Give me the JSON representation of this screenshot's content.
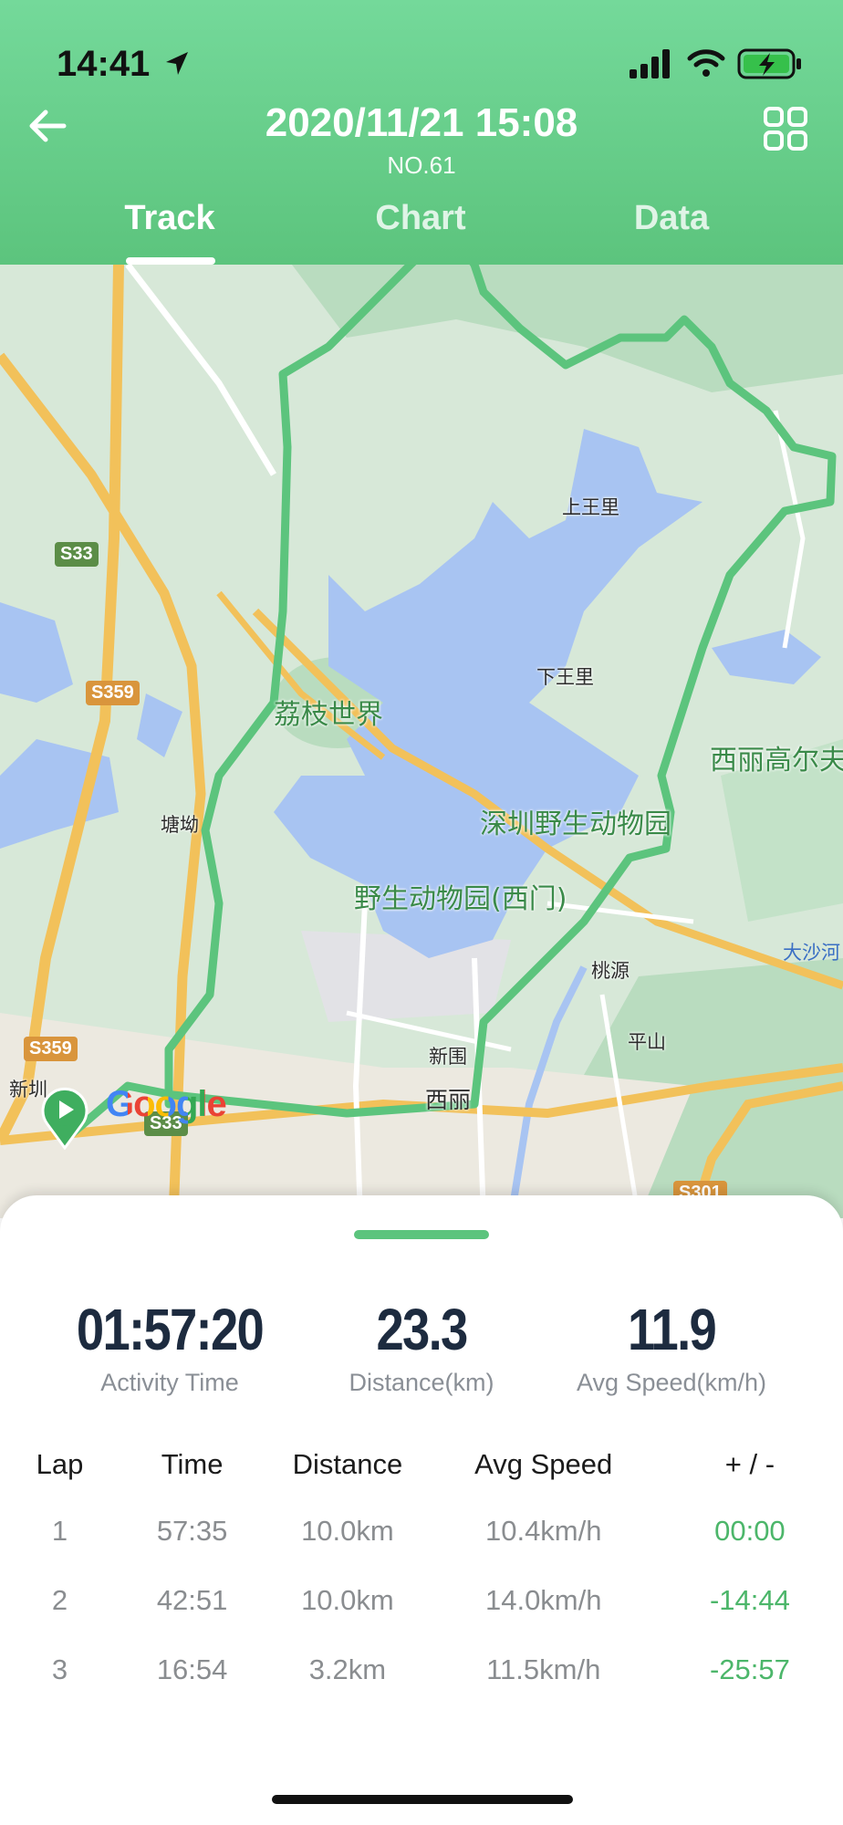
{
  "status_bar": {
    "time": "14:41"
  },
  "header": {
    "title": "2020/11/21 15:08",
    "subtitle": "NO.61"
  },
  "tabs": [
    {
      "label": "Track",
      "active": true
    },
    {
      "label": "Chart",
      "active": false
    },
    {
      "label": "Data",
      "active": false
    }
  ],
  "map": {
    "labels": {
      "lizhi": "荔枝世界",
      "zoo": "深圳野生动物园",
      "zoo_west": "野生动物园(西门)",
      "xili_golf": "西丽高尔夫",
      "shangwangli": "上王里",
      "xiawangli": "下王里",
      "tangao": "塘坳",
      "taoyuan": "桃源",
      "pingshan": "平山",
      "xinwei": "新围",
      "xili": "西丽",
      "dashahe": "大沙河",
      "xinqiao": "新圳"
    },
    "shields": {
      "s33": "S33",
      "s359a": "S359",
      "s359b": "S359",
      "s33b": "S33",
      "s301": "S301"
    },
    "attribution": "Google",
    "route_color": "#5cc47d"
  },
  "summary": [
    {
      "value": "01:57:20",
      "label": "Activity Time"
    },
    {
      "value": "23.3",
      "label": "Distance(km)"
    },
    {
      "value": "11.9",
      "label": "Avg Speed(km/h)"
    }
  ],
  "laps": {
    "headers": [
      "Lap",
      "Time",
      "Distance",
      "Avg Speed",
      "+ / -"
    ],
    "rows": [
      [
        "1",
        "57:35",
        "10.0km",
        "10.4km/h",
        "00:00"
      ],
      [
        "2",
        "42:51",
        "10.0km",
        "14.0km/h",
        "-14:44"
      ],
      [
        "3",
        "16:54",
        "3.2km",
        "11.5km/h",
        "-25:57"
      ]
    ]
  }
}
